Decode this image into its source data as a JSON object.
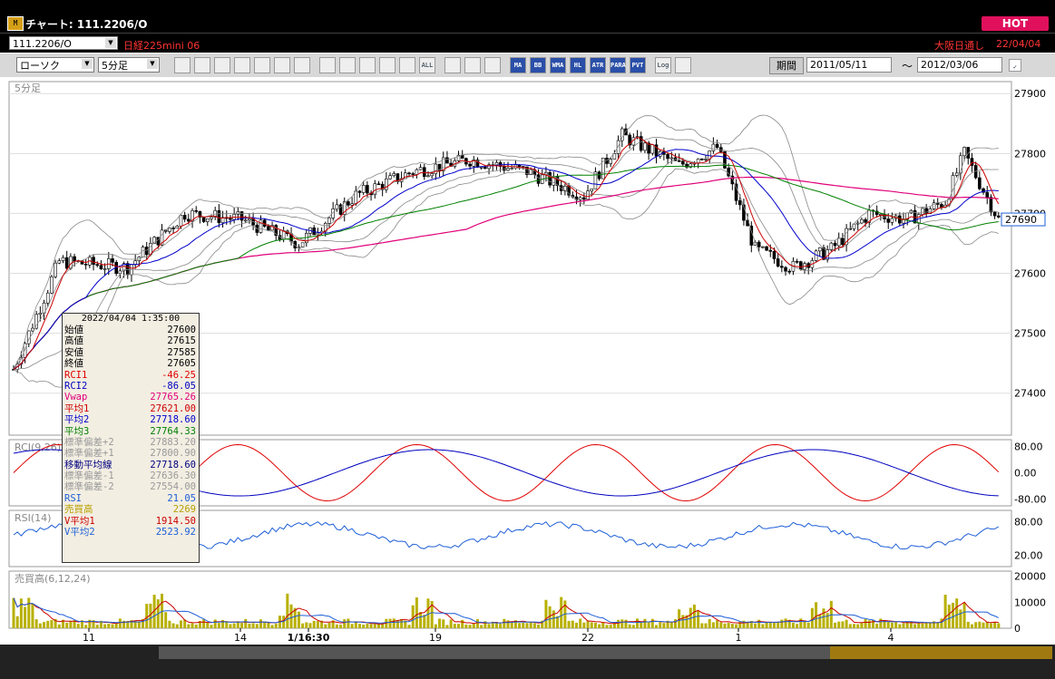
{
  "window": {
    "title": "チャート: 111.2206/O",
    "icon": "chart-app-icon",
    "hot_label": "HOT"
  },
  "header": {
    "symbol_code": "111.2206/O",
    "symbol_name": "日経225mini 06",
    "exchange": "大阪日通し",
    "date": "22/04/04"
  },
  "toolbar": {
    "chart_type": "ローソク",
    "interval": "5分足",
    "buttons_a": [
      "zoom-icon",
      "grid-icon",
      "candle-style-icon",
      "ticker-icon",
      "compare-icon",
      "indicator-icon",
      "info-icon"
    ],
    "buttons_b": [
      "trendline-icon",
      "cursor-icon",
      "undo-icon",
      "bar-icon",
      "line-icon"
    ],
    "all_label": "ALL",
    "buttons_c": [
      "settings-icon",
      "pen-icon",
      "color-icon"
    ],
    "indicators": [
      "MA",
      "BB",
      "WMA",
      "HL",
      "ATR",
      "PARA",
      "PVT"
    ],
    "log_label": "Log",
    "period_label": "期間",
    "date_from": "2011/05/11",
    "tilde": "〜",
    "date_to": "2012/03/06"
  },
  "colors": {
    "candle_up": "#ffffff",
    "candle_down": "#000000",
    "rci1": "#e00000",
    "rci2": "#0000c0",
    "vwap": "#e0007a",
    "ma1": "#cc0000",
    "ma2": "#0000cc",
    "ma3": "#008000",
    "bb": "#888888",
    "rsi": "#1e5fd8",
    "volume": "#b8b000"
  },
  "main_panel": {
    "label": "5分足",
    "price_ticks": [
      "27900",
      "27800",
      "27700",
      "27600",
      "27500",
      "27400"
    ],
    "current_price": "27690"
  },
  "rci_panel": {
    "label": "RCI(9,26)",
    "ticks": [
      "80.00",
      "0.00",
      "-80.00"
    ]
  },
  "rsi_panel": {
    "label": "RSI(14)",
    "ticks": [
      "80.00",
      "20.00"
    ]
  },
  "volume_panel": {
    "label": "売買高(6,12,24)",
    "ticks": [
      "20000",
      "10000",
      "0"
    ]
  },
  "x_axis": {
    "ticks": [
      "11",
      "14",
      "1/16:30",
      "19",
      "22",
      "1",
      "4"
    ]
  },
  "info": {
    "timestamp": "2022/04/04  1:35:00",
    "rows": [
      {
        "label": "始値",
        "value": "27600",
        "color": "#000"
      },
      {
        "label": "高値",
        "value": "27615",
        "color": "#000"
      },
      {
        "label": "安値",
        "value": "27585",
        "color": "#000"
      },
      {
        "label": "終値",
        "value": "27605",
        "color": "#000"
      },
      {
        "label": "RCI1",
        "value": "-46.25",
        "color": "#e00000"
      },
      {
        "label": "RCI2",
        "value": "-86.05",
        "color": "#0000c0"
      },
      {
        "label": "Vwap",
        "value": "27765.26",
        "color": "#e0007a"
      },
      {
        "label": "平均1",
        "value": "27621.00",
        "color": "#cc0000"
      },
      {
        "label": "平均2",
        "value": "27718.60",
        "color": "#0000cc"
      },
      {
        "label": "平均3",
        "value": "27764.33",
        "color": "#008000"
      },
      {
        "label": "標準偏差+2",
        "value": "27883.20",
        "color": "#999"
      },
      {
        "label": "標準偏差+1",
        "value": "27800.90",
        "color": "#999"
      },
      {
        "label": "移動平均線",
        "value": "27718.60",
        "color": "#000080"
      },
      {
        "label": "標準偏差-1",
        "value": "27636.30",
        "color": "#999"
      },
      {
        "label": "標準偏差-2",
        "value": "27554.00",
        "color": "#999"
      },
      {
        "label": "RSI",
        "value": "21.05",
        "color": "#1e5fd8"
      },
      {
        "label": "売買高",
        "value": "2269",
        "color": "#b8a000"
      },
      {
        "label": "V平均1",
        "value": "1914.50",
        "color": "#cc0000"
      },
      {
        "label": "V平均2",
        "value": "2523.92",
        "color": "#1e5fd8"
      }
    ]
  }
}
